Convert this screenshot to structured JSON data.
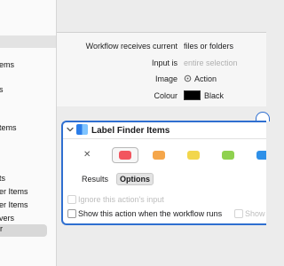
{
  "sidebar": {
    "items": [
      {
        "label": "ems"
      },
      {
        "label": "s"
      },
      {
        "label": "tems"
      },
      {
        "label": "ts"
      },
      {
        "label": "er Items"
      },
      {
        "label": "er Items"
      },
      {
        "label": "vers"
      },
      {
        "label": "r"
      }
    ]
  },
  "workflow": {
    "receives_label": "Workflow receives current",
    "receives_value": "files or folders",
    "input_label": "Input is",
    "input_placeholder": "entire selection",
    "image_label": "Image",
    "image_value": "Action",
    "colour_label": "Colour",
    "colour_value": "Black",
    "colour_hex": "#000000"
  },
  "action": {
    "title": "Label Finder Items",
    "clear_glyph": "✕",
    "swatches": [
      {
        "name": "red",
        "color": "#f2555f",
        "selected": true
      },
      {
        "name": "orange",
        "color": "#f5a64a"
      },
      {
        "name": "yellow",
        "color": "#f2d64c"
      },
      {
        "name": "green",
        "color": "#8fd14f"
      },
      {
        "name": "blue",
        "color": "#2e90e8"
      }
    ],
    "tabs": [
      {
        "label": "Results"
      },
      {
        "label": "Options"
      }
    ],
    "ignore_input_label": "Ignore this action's input",
    "show_when_runs_label": "Show this action when the workflow runs",
    "show_truncated_label": "Show"
  },
  "colors": {
    "accent": "#2f6fd0"
  }
}
